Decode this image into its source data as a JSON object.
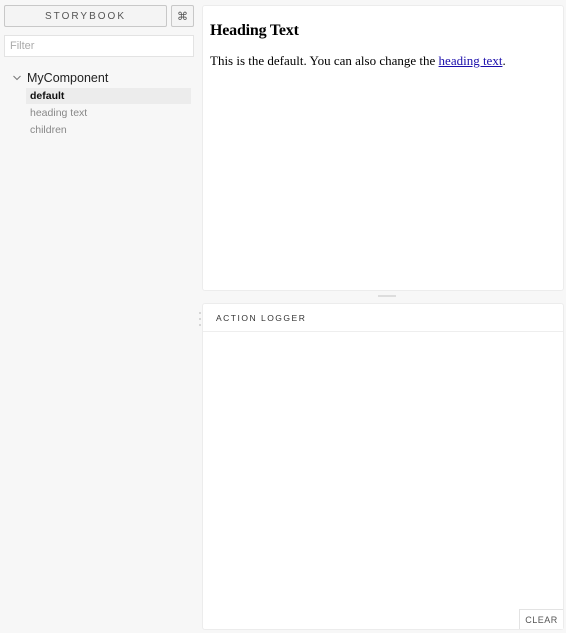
{
  "sidebar": {
    "brand_label": "STORYBOOK",
    "shortcut_icon": "⌘",
    "filter_placeholder": "Filter",
    "kind": {
      "label": "MyComponent",
      "expanded": true
    },
    "stories": [
      {
        "label": "default",
        "selected": true
      },
      {
        "label": "heading text",
        "selected": false
      },
      {
        "label": "children",
        "selected": false
      }
    ]
  },
  "preview": {
    "heading": "Heading Text",
    "text_before": "This is the default. You can also change the ",
    "link_text": "heading text",
    "text_after": "."
  },
  "panel": {
    "tab_label": "ACTION LOGGER",
    "clear_label": "CLEAR"
  }
}
